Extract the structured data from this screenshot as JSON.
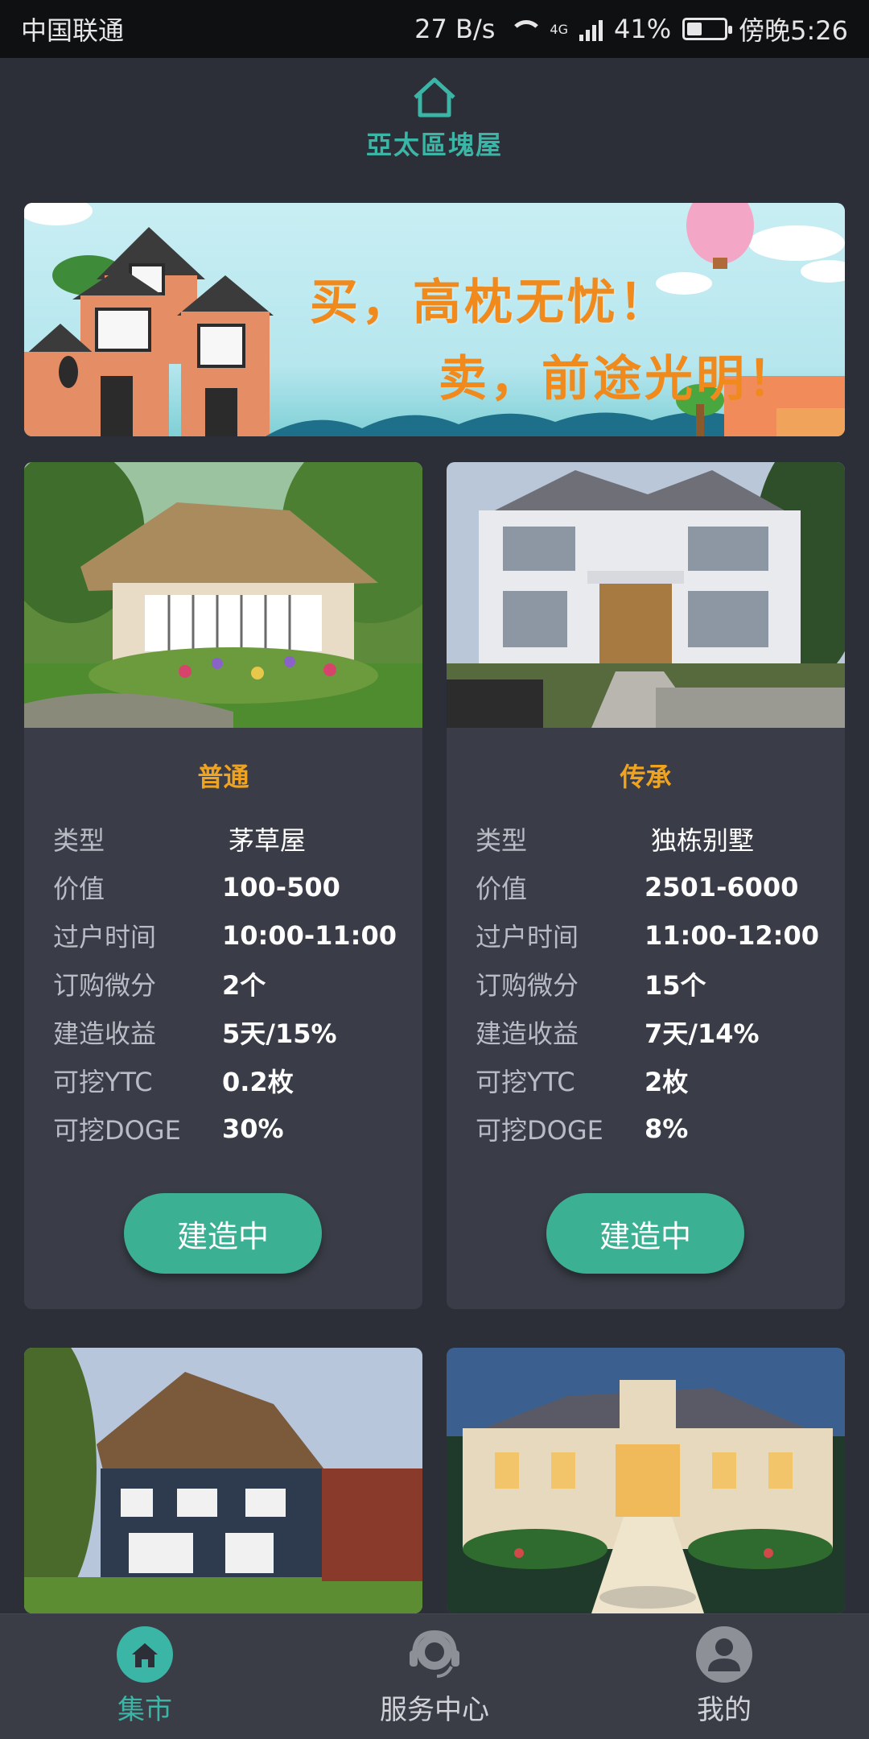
{
  "status_bar": {
    "carrier": "中国联通",
    "speed": "27 B/s",
    "network": "4G",
    "battery": "41%",
    "battery_level": 0.41,
    "time": "傍晚5:26"
  },
  "header": {
    "logo_icon": "home-icon",
    "title": "亞太區塊屋"
  },
  "banner": {
    "line1": "买，高枕无忧！",
    "line2": "卖，前途光明！"
  },
  "labels": {
    "type": "类型",
    "value": "价值",
    "transfer_time": "过户时间",
    "order_points": "订购微分",
    "build_yield": "建造收益",
    "ytc": "可挖YTC",
    "doge": "可挖DOGE"
  },
  "cards": [
    {
      "title": "普通",
      "type": "茅草屋",
      "value": "100-500",
      "transfer_time": "10:00-11:00",
      "order_points": "2个",
      "build_yield": "5天/15%",
      "ytc": "0.2枚",
      "doge": "30%",
      "button": "建造中"
    },
    {
      "title": "传承",
      "type": "独栋别墅",
      "value": "2501-6000",
      "transfer_time": "11:00-12:00",
      "order_points": "15个",
      "build_yield": "7天/14%",
      "ytc": "2枚",
      "doge": "8%",
      "button": "建造中"
    }
  ],
  "colors": {
    "accent": "#3bb5a5",
    "button": "#3bb093",
    "title_orange": "#f0a31f",
    "background": "#2c2f38",
    "card": "#3a3d47"
  },
  "bottom_nav": [
    {
      "label": "集市",
      "icon": "home-icon",
      "active": true
    },
    {
      "label": "服务中心",
      "icon": "headset-icon",
      "active": false
    },
    {
      "label": "我的",
      "icon": "user-icon",
      "active": false
    }
  ]
}
